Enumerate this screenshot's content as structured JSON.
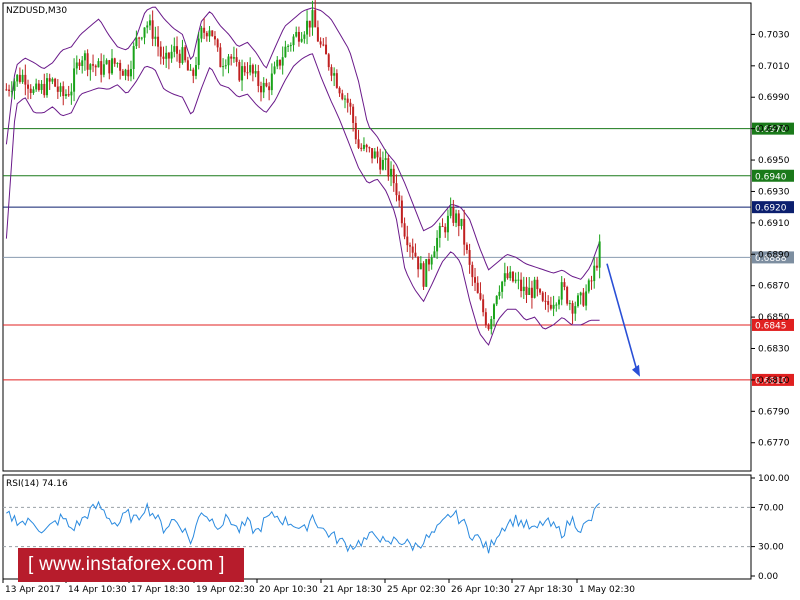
{
  "chart_data": {
    "type": "candlestick",
    "title": "NZDUSD,M30",
    "main": {
      "ylim": [
        0.6752,
        0.705
      ],
      "yticks": [
        0.703,
        0.701,
        0.699,
        0.697,
        0.695,
        0.693,
        0.691,
        0.689,
        0.687,
        0.685,
        0.683,
        0.681,
        0.679,
        0.677
      ],
      "ytick_labels": [
        "0.7030",
        "0.7010",
        "0.6990",
        "0.6970",
        "0.6950",
        "0.6930",
        "0.6910",
        "0.6890",
        "0.6870",
        "0.6850",
        "0.6830",
        "0.6810",
        "0.6790",
        "0.6770"
      ],
      "levels": [
        {
          "value": 0.697,
          "label": "0.6970",
          "color": "#1a7a1a",
          "line": "#1a7a1a"
        },
        {
          "value": 0.694,
          "label": "0.6940",
          "color": "#1a7a1a",
          "line": "#1a7a1a"
        },
        {
          "value": 0.692,
          "label": "0.6920",
          "color": "#0b1f6e",
          "line": "#0b1f6e"
        },
        {
          "value": 0.6888,
          "label": "0.6888",
          "color": "#7d8ea0",
          "line": "#8a9bb0"
        },
        {
          "value": 0.6845,
          "label": "0.6845",
          "color": "#e02020",
          "line": "#e02020"
        },
        {
          "value": 0.681,
          "label": "0.6810",
          "color": "#e02020",
          "line": "#e02020"
        }
      ],
      "price_path": [
        0.6995,
        0.7002,
        0.7004,
        0.6992,
        0.6996,
        0.7,
        0.699,
        0.6996,
        0.7018,
        0.7012,
        0.7008,
        0.701,
        0.7012,
        0.7005,
        0.7025,
        0.7038,
        0.703,
        0.701,
        0.702,
        0.7016,
        0.7,
        0.703,
        0.7036,
        0.7012,
        0.7018,
        0.7005,
        0.701,
        0.7,
        0.6995,
        0.7006,
        0.702,
        0.7028,
        0.7034,
        0.704,
        0.702,
        0.701,
        0.6996,
        0.6985,
        0.6958,
        0.6955,
        0.6952,
        0.6945,
        0.6934,
        0.6905,
        0.6892,
        0.6875,
        0.6895,
        0.6905,
        0.6915,
        0.691,
        0.688,
        0.686,
        0.6845,
        0.687,
        0.6875,
        0.6872,
        0.6865,
        0.6868,
        0.6855,
        0.6862,
        0.6868,
        0.6858,
        0.686,
        0.687,
        0.6893
      ],
      "upper_band": [
        0.696,
        0.701,
        0.7015,
        0.7012,
        0.7008,
        0.7012,
        0.702,
        0.7022,
        0.703,
        0.7035,
        0.704,
        0.703,
        0.7022,
        0.702,
        0.7028,
        0.7045,
        0.7048,
        0.704,
        0.7034,
        0.703,
        0.7012,
        0.7038,
        0.7045,
        0.7036,
        0.703,
        0.7022,
        0.7025,
        0.7018,
        0.7008,
        0.7022,
        0.7035,
        0.704,
        0.7045,
        0.7047,
        0.7045,
        0.704,
        0.703,
        0.702,
        0.7,
        0.6972,
        0.6965,
        0.6955,
        0.6948,
        0.6935,
        0.692,
        0.6905,
        0.6908,
        0.6915,
        0.6922,
        0.692,
        0.6912,
        0.6895,
        0.688,
        0.6885,
        0.689,
        0.6888,
        0.6884,
        0.6882,
        0.688,
        0.6878,
        0.688,
        0.6876,
        0.6874,
        0.6882,
        0.6898
      ],
      "lower_band": [
        0.69,
        0.6985,
        0.699,
        0.698,
        0.698,
        0.6984,
        0.6978,
        0.698,
        0.6992,
        0.6994,
        0.6996,
        0.6995,
        0.6998,
        0.6992,
        0.7,
        0.701,
        0.7008,
        0.6995,
        0.6992,
        0.699,
        0.6978,
        0.6995,
        0.701,
        0.6998,
        0.6996,
        0.699,
        0.6992,
        0.6985,
        0.698,
        0.6988,
        0.7,
        0.701,
        0.7015,
        0.7018,
        0.7002,
        0.6988,
        0.6975,
        0.696,
        0.6945,
        0.6935,
        0.6938,
        0.693,
        0.6915,
        0.688,
        0.6868,
        0.686,
        0.6872,
        0.6885,
        0.6892,
        0.6885,
        0.686,
        0.684,
        0.6832,
        0.6848,
        0.6855,
        0.6855,
        0.6848,
        0.685,
        0.6842,
        0.6845,
        0.685,
        0.6845,
        0.6845,
        0.6848,
        0.6848
      ],
      "forecast_arrow": {
        "from": [
          0.6888,
          0.6884
        ],
        "to": [
          0.681,
          0.6812
        ],
        "color": "#2a4fd6"
      }
    },
    "rsi": {
      "label": "RSI(14) 74.16",
      "ylim": [
        0,
        100
      ],
      "yticks": [
        100,
        70,
        30,
        0
      ],
      "ytick_labels": [
        "100.00",
        "70.00",
        "30.00",
        "0.00"
      ],
      "values": [
        62,
        58,
        54,
        56,
        44,
        52,
        60,
        48,
        55,
        66,
        72,
        60,
        52,
        64,
        56,
        72,
        62,
        48,
        58,
        50,
        34,
        68,
        58,
        52,
        60,
        46,
        54,
        44,
        58,
        62,
        56,
        54,
        44,
        62,
        48,
        42,
        36,
        30,
        34,
        38,
        44,
        30,
        38,
        34,
        30,
        36,
        42,
        52,
        64,
        58,
        44,
        38,
        26,
        44,
        54,
        58,
        52,
        46,
        56,
        50,
        44,
        58,
        48,
        56,
        74.16
      ]
    },
    "x": {
      "tick_labels": [
        "13 Apr 2017",
        "14 Apr 10:30",
        "17 Apr 18:30",
        "19 Apr 02:30",
        "20 Apr 10:30",
        "21 Apr 18:30",
        "25 Apr 02:30",
        "26 Apr 10:30",
        "27 Apr 18:30",
        "1 May 02:30"
      ]
    },
    "colors": {
      "bull": "#1aa31a",
      "bear": "#c02020",
      "band": "#6a1a8a",
      "rsi": "#2a8adf",
      "border": "#000000"
    }
  },
  "watermark": {
    "text": "[  www.instaforex.com ]"
  }
}
